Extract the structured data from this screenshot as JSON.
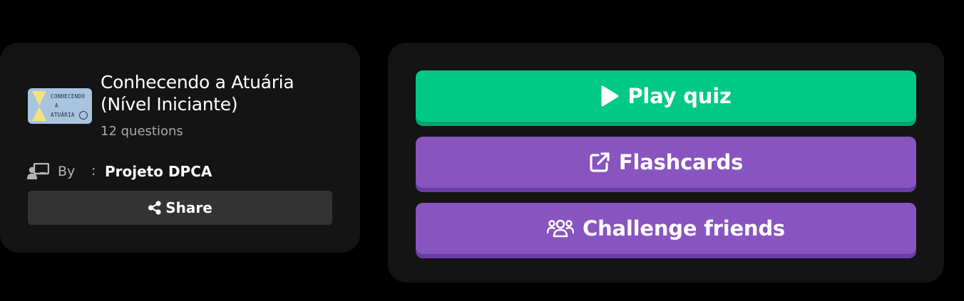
{
  "quiz": {
    "title_line1": "Conhecendo a Atuária",
    "title_line2": "(Nível Iniciante)",
    "question_count": "12 questions",
    "thumbnail": {
      "line1": "CONHECENDO",
      "line2": "A",
      "line3": "ATUÁRIA"
    }
  },
  "author": {
    "by_label": "By",
    "separator": ":",
    "name": "Projeto DPCA"
  },
  "share": {
    "label": "Share",
    "icon": "share-icon"
  },
  "actions": {
    "play": {
      "label": "Play quiz",
      "icon": "play-icon",
      "color": "#00c985"
    },
    "flashcards": {
      "label": "Flashcards",
      "icon": "external-link-icon",
      "color": "#8854c0"
    },
    "challenge": {
      "label": "Challenge friends",
      "icon": "users-icon",
      "color": "#8854c0"
    }
  }
}
